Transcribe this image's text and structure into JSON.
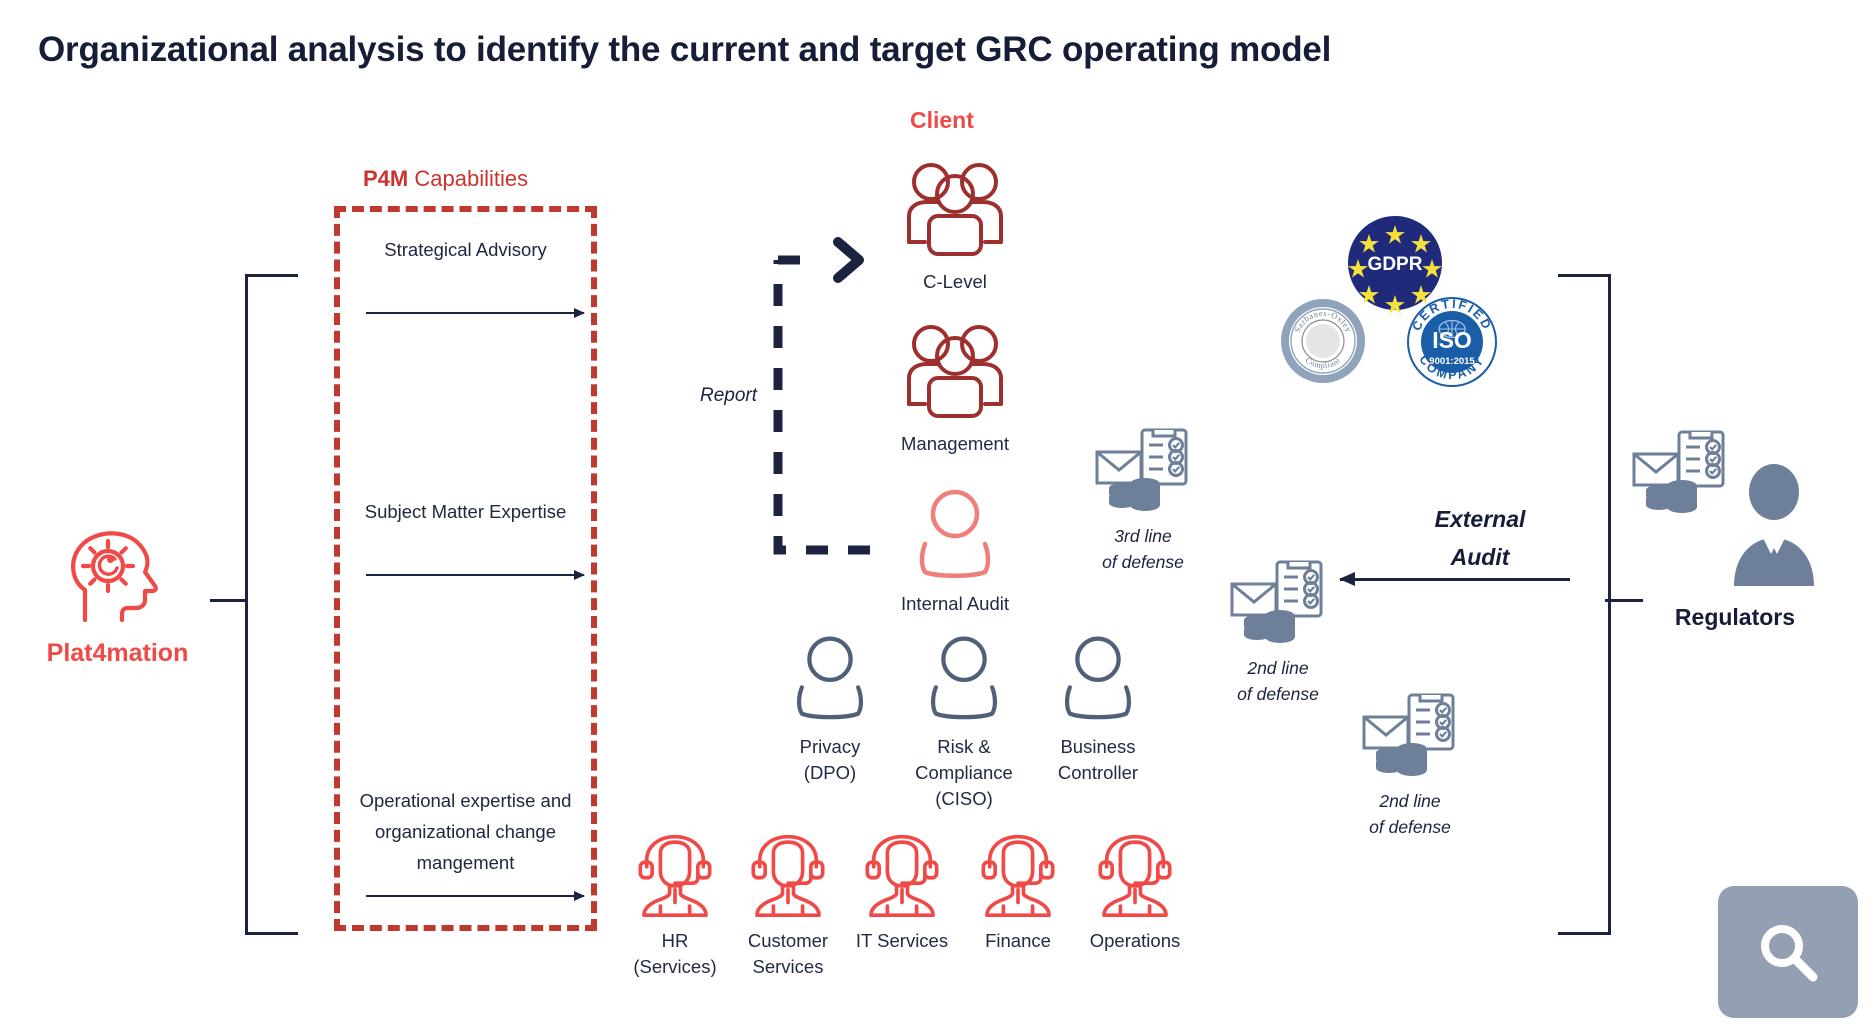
{
  "page": {
    "title": "Organizational analysis to identify the current and target GRC operating model"
  },
  "headings": {
    "client": "Client",
    "p4m_bold": "P4M",
    "p4m_rest": " Capabilities"
  },
  "plat4mation": {
    "label": "Plat4mation",
    "icon": "head-with-gear-icon",
    "color": "#ef4a47"
  },
  "capabilities": [
    {
      "label": "Strategical\nAdvisory",
      "arrow": "right-arrow"
    },
    {
      "label": "Subject Matter\nExpertise",
      "arrow": "right-arrow"
    },
    {
      "label": "Operational expertise\nand organizational\nchange mangement",
      "arrow": "right-arrow"
    }
  ],
  "report_flow": {
    "label": "Report",
    "style": "dashed",
    "arrowhead": "chevron-right-icon"
  },
  "client_nodes": [
    {
      "label": "C-Level",
      "icon": "people-group-icon",
      "color": "#9e2f2f"
    },
    {
      "label": "Management",
      "icon": "people-group-icon",
      "color": "#9e2f2f"
    },
    {
      "label": "Internal Audit",
      "icon": "person-icon",
      "color": "#ef7f7b"
    }
  ],
  "governance_roles": [
    {
      "label": "Privacy\n(DPO)",
      "icon": "person-icon",
      "color": "#516079"
    },
    {
      "label": "Risk &\nCompliance\n(CISO)",
      "icon": "person-icon",
      "color": "#516079"
    },
    {
      "label": "Business\nController",
      "icon": "person-icon",
      "color": "#516079"
    }
  ],
  "service_roles": [
    {
      "label": "HR\n(Services)",
      "icon": "headset-agent-icon",
      "color": "#ef4a47"
    },
    {
      "label": "Customer\nServices",
      "icon": "headset-agent-icon",
      "color": "#ef4a47"
    },
    {
      "label": "IT Services",
      "icon": "headset-agent-icon",
      "color": "#ef4a47"
    },
    {
      "label": "Finance",
      "icon": "headset-agent-icon",
      "color": "#ef4a47"
    },
    {
      "label": "Operations",
      "icon": "headset-agent-icon",
      "color": "#ef4a47"
    }
  ],
  "lines_of_defense": [
    {
      "label": "3rd line\nof defense",
      "icon": "envelope-checklist-coins-icon"
    },
    {
      "label": "2nd line\nof defense",
      "icon": "envelope-checklist-coins-icon"
    },
    {
      "label": "2nd line\nof defense",
      "icon": "envelope-checklist-coins-icon"
    }
  ],
  "external_audit": {
    "label": "External\nAudit",
    "arrow": "left-arrow"
  },
  "regulators": {
    "label": "Regulators",
    "icon": "businessman-icon",
    "accessory_icon": "envelope-checklist-coins-icon"
  },
  "badges": [
    {
      "name": "gdpr-badge",
      "text": "GDPR",
      "color": "#1f2a7a",
      "star_color": "#f5e13c"
    },
    {
      "name": "sarbanes-oxley-badge",
      "top_text": "Sarbanes-Oxley",
      "bottom_text": "Compliant",
      "color": "#8fa3bb"
    },
    {
      "name": "iso-badge",
      "top_text": "CERTIFIED",
      "center_text": "ISO",
      "sub_text": "9001:2015",
      "bottom_text": "COMPANY",
      "color": "#1b5ea8"
    }
  ],
  "search_overlay": {
    "icon": "search-icon",
    "background": "#93a0b4"
  },
  "colors": {
    "navy": "#1b2340",
    "red": "#ef4a47",
    "dark_red": "#9e2f2f",
    "slate": "#516079",
    "badge_blue": "#1b5ea8"
  }
}
